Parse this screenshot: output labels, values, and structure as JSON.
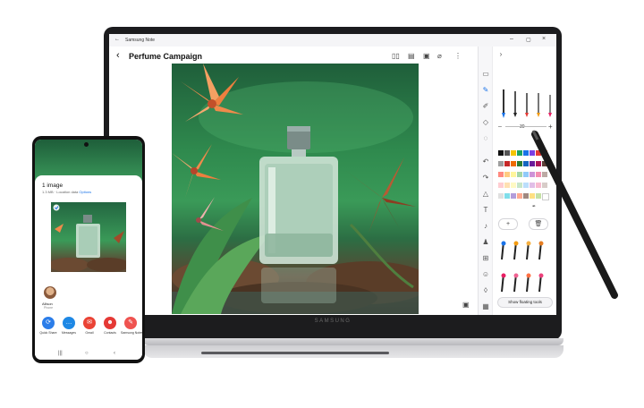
{
  "laptop": {
    "brand": "SAMSUNG",
    "window": {
      "app_title": "Samsung Note",
      "back_glyph": "←",
      "min": "–",
      "max": "▢",
      "close": "×"
    },
    "document": {
      "title": "Perfume Campaign",
      "back_glyph": "‹"
    },
    "header_icons": [
      "book-icon",
      "document-icon",
      "image-icon",
      "attach-icon",
      "more-icon"
    ],
    "pen_panel": {
      "thickness_value": "30",
      "plus_label": "+",
      "trash_glyph": "🗑",
      "floating_tools_label": "Show floating tools"
    }
  },
  "phone": {
    "share": {
      "title": "1 image",
      "subtitle_prefix": "1.3 MB · Location data",
      "subtitle_link": "Options"
    },
    "contact": {
      "name": "Allison",
      "sub": "Phone"
    },
    "apps": [
      {
        "label": "Quick Share",
        "color": "#2b7de9",
        "glyph": "⟳"
      },
      {
        "label": "Messages",
        "color": "#1e88e5",
        "glyph": "…"
      },
      {
        "label": "Gmail",
        "color": "#ea4335",
        "glyph": "✉"
      },
      {
        "label": "Contacts",
        "color": "#e53935",
        "glyph": "☻"
      },
      {
        "label": "Samsung Notes",
        "color": "#ef5350",
        "glyph": "✎"
      }
    ],
    "nav": {
      "recents": "|||",
      "home": "○",
      "back": "‹"
    }
  },
  "colors": {
    "accent": "#1a73e8",
    "bezel": "#1c1c1e",
    "leaf_green": "#3a9a58"
  }
}
